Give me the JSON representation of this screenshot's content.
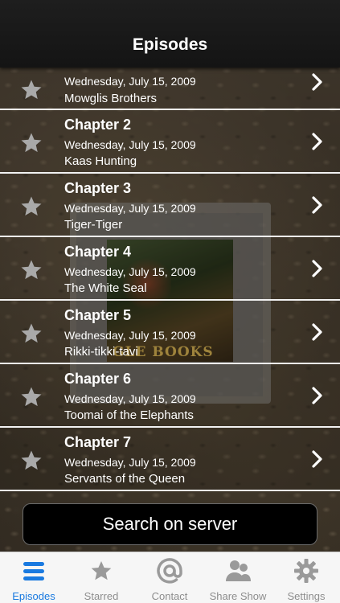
{
  "header": {
    "title": "Episodes"
  },
  "cover": {
    "text": "GLE BOOKS"
  },
  "episodes": [
    {
      "title": "",
      "date": "Wednesday, July 15, 2009",
      "subtitle": "Mowglis Brothers"
    },
    {
      "title": "Chapter 2",
      "date": "Wednesday, July 15, 2009",
      "subtitle": "Kaas Hunting"
    },
    {
      "title": "Chapter 3",
      "date": "Wednesday, July 15, 2009",
      "subtitle": "Tiger-Tiger"
    },
    {
      "title": "Chapter 4",
      "date": "Wednesday, July 15, 2009",
      "subtitle": "The White Seal"
    },
    {
      "title": "Chapter 5",
      "date": "Wednesday, July 15, 2009",
      "subtitle": "Rikki-tikki-tavi"
    },
    {
      "title": "Chapter 6",
      "date": "Wednesday, July 15, 2009",
      "subtitle": "Toomai of the Elephants"
    },
    {
      "title": "Chapter 7",
      "date": "Wednesday, July 15, 2009",
      "subtitle": "Servants of the Queen"
    }
  ],
  "search": {
    "label": "Search on server"
  },
  "tabs": [
    {
      "label": "Episodes",
      "icon": "list-icon",
      "active": true
    },
    {
      "label": "Starred",
      "icon": "star-icon",
      "active": false
    },
    {
      "label": "Contact",
      "icon": "at-sign-icon",
      "active": false
    },
    {
      "label": "Share Show",
      "icon": "people-icon",
      "active": false
    },
    {
      "label": "Settings",
      "icon": "gear-icon",
      "active": false
    }
  ],
  "colors": {
    "accent": "#1a7ae0",
    "inactive": "#8e8e8e",
    "separator": "#f2f2f2"
  }
}
